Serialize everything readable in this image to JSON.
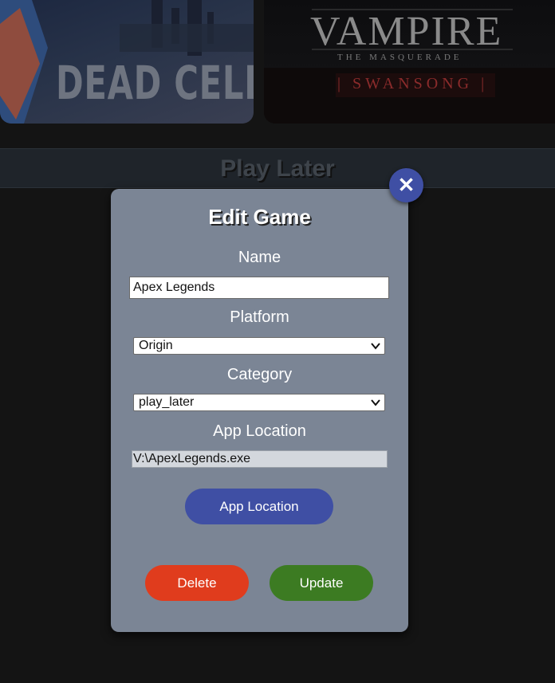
{
  "library": {
    "covers": [
      {
        "title": "DEAD CELLS"
      },
      {
        "title": "VAMPIRE",
        "subtitle": "THE MASQUERADE",
        "edition": "| SWANSONG |"
      }
    ],
    "section_title": "Play Later"
  },
  "modal": {
    "title": "Edit Game",
    "close_symbol": "✕",
    "name": {
      "label": "Name",
      "value": "Apex Legends"
    },
    "platform": {
      "label": "Platform",
      "selected": "Origin"
    },
    "category": {
      "label": "Category",
      "selected": "play_later"
    },
    "app_location": {
      "label": "App Location",
      "value": "V:\\ApexLegends.exe",
      "button_label": "App Location"
    },
    "delete_label": "Delete",
    "update_label": "Update"
  },
  "colors": {
    "modal_bg": "#7b8595",
    "accent_blue": "#3f4fa4",
    "delete_red": "#e03c1d",
    "update_green": "#3c7b22",
    "page_bg": "#141414"
  }
}
